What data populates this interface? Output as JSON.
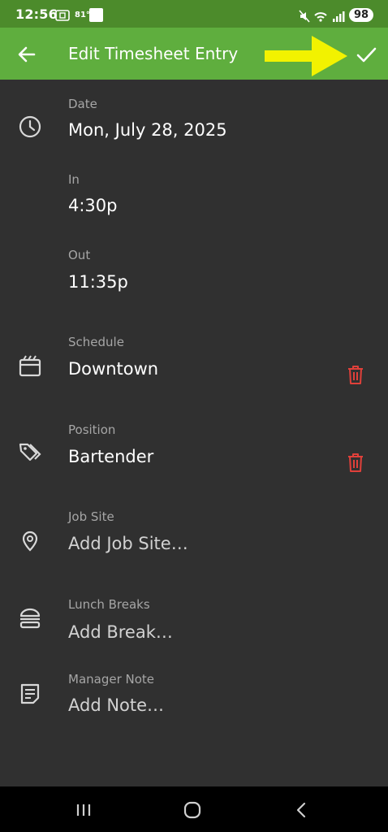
{
  "status_bar": {
    "time": "12:56",
    "temperature": "81°",
    "weather_logo": "The Weather Channel",
    "battery": "98",
    "icons": [
      "screenshot-icon",
      "mute-icon",
      "wifi-icon",
      "signal-icon"
    ]
  },
  "app_bar": {
    "title": "Edit Timesheet Entry",
    "back_icon": "back-arrow-icon",
    "save_icon": "check-icon",
    "annotation": "yellow-arrow-icon",
    "bar_color": "#5fae3e"
  },
  "fields": {
    "date": {
      "label": "Date",
      "value": "Mon, July 28, 2025",
      "icon": "clock-icon"
    },
    "in": {
      "label": "In",
      "value": "4:30p"
    },
    "out": {
      "label": "Out",
      "value": "11:35p"
    },
    "schedule": {
      "label": "Schedule",
      "value": "Downtown",
      "icon": "calendar-icon",
      "delete_icon": "trash-icon"
    },
    "position": {
      "label": "Position",
      "value": "Bartender",
      "icon": "tags-icon",
      "delete_icon": "trash-icon"
    },
    "job_site": {
      "label": "Job Site",
      "placeholder": "Add Job Site…",
      "icon": "location-pin-icon"
    },
    "lunch_breaks": {
      "label": "Lunch Breaks",
      "placeholder": "Add Break…",
      "icon": "burger-icon"
    },
    "manager_note": {
      "label": "Manager Note",
      "placeholder": "Add Note…",
      "icon": "note-icon"
    }
  },
  "colors": {
    "background": "#303030",
    "delete": "#e0403a",
    "annotation_arrow": "#f2f200"
  },
  "nav_bar": {
    "icons": [
      "recent-apps-icon",
      "home-icon",
      "system-back-icon"
    ]
  }
}
